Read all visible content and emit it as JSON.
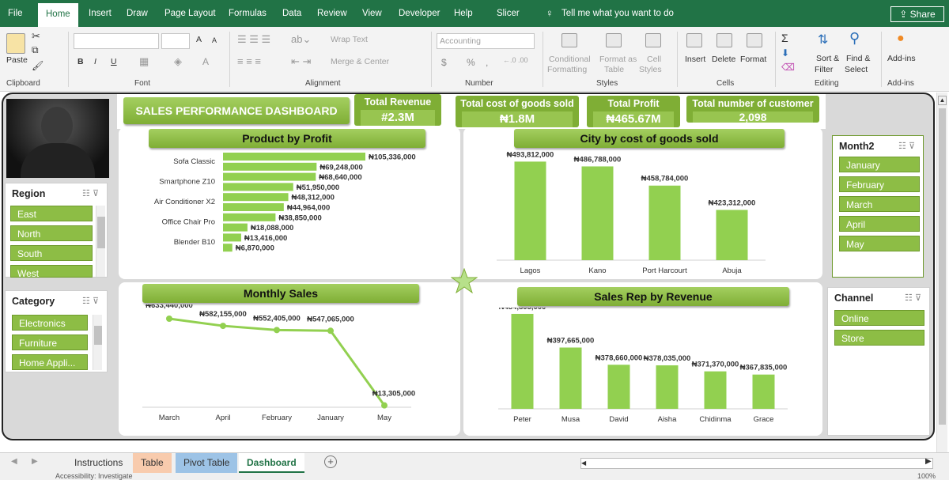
{
  "menu": {
    "items": [
      "File",
      "Home",
      "Insert",
      "Draw",
      "Page Layout",
      "Formulas",
      "Data",
      "Review",
      "View",
      "Developer",
      "Help",
      "Slicer"
    ],
    "tell_me": "Tell me what you want to do",
    "share": "Share"
  },
  "ribbon": {
    "clipboard": {
      "paste": "Paste",
      "label": "Clipboard"
    },
    "font": {
      "bold": "B",
      "italic": "I",
      "underline": "U",
      "grow": "A",
      "shrink": "A",
      "color": "A",
      "label": "Font"
    },
    "alignment": {
      "wrap": "Wrap Text",
      "merge": "Merge & Center",
      "label": "Alignment"
    },
    "number": {
      "format": "Accounting",
      "currency": "$",
      "percent": "%",
      "comma": ",",
      "inc": "←.0 .00",
      "dec": ".00 →.0",
      "label": "Number"
    },
    "styles": {
      "conditional": "Conditional",
      "formatting": "Formatting",
      "format_as": "Format as",
      "table": "Table",
      "cell": "Cell",
      "styles": "Styles",
      "label": "Styles"
    },
    "cells": {
      "insert": "Insert",
      "delete": "Delete",
      "format": "Format",
      "label": "Cells"
    },
    "editing": {
      "sort": "Sort &",
      "filter": "Filter",
      "find": "Find &",
      "select": "Select",
      "label": "Editing"
    },
    "addins": {
      "button": "Add-ins",
      "label": "Add-ins"
    }
  },
  "dashboard": {
    "title": "SALES PERFORMANCE  DASHBOARD",
    "kpis": [
      {
        "label": "Total Revenue",
        "value": "#2.3M"
      },
      {
        "label": "Total cost of goods sold",
        "value": "₦1.8M"
      },
      {
        "label": "Total Profit",
        "value": "₦465.67M"
      },
      {
        "label": "Total number of customer",
        "value": "2,098"
      }
    ]
  },
  "slicers": {
    "region": {
      "title": "Region",
      "items": [
        "East",
        "North",
        "South",
        "West"
      ]
    },
    "category": {
      "title": "Category",
      "items": [
        "Electronics",
        "Furniture",
        "Home Appli..."
      ]
    },
    "month": {
      "title": "Month2",
      "items": [
        "January",
        "February",
        "March",
        "April",
        "May"
      ]
    },
    "channel": {
      "title": "Channel",
      "items": [
        "Online",
        "Store"
      ]
    }
  },
  "chart_data": [
    {
      "type": "bar",
      "orientation": "horizontal",
      "title": "Product by Profit",
      "categories": [
        "",
        "Sofa Classic",
        "",
        "",
        "Smartphone Z10",
        "",
        "",
        "Air Conditioner X2",
        "",
        "",
        "Office Chair Pro",
        "",
        "",
        "Blender B10"
      ],
      "values": [
        105336000,
        69248000,
        68640000,
        51950000,
        48312000,
        44964000,
        38850000,
        18088000,
        13416000,
        6870000
      ],
      "tick_labels": [
        {
          "text": "Sofa Classic",
          "bar": 1
        },
        {
          "text": "Smartphone Z10",
          "bar": 3
        },
        {
          "text": "Air Conditioner X2",
          "bar": 5
        },
        {
          "text": "Office Chair Pro",
          "bar": 7
        },
        {
          "text": "Blender B10",
          "bar": 9
        }
      ],
      "data_labels": [
        "₦105,336,000",
        "₦69,248,000",
        "₦68,640,000",
        "₦51,950,000",
        "₦48,312,000",
        "₦44,964,000",
        "₦38,850,000",
        "₦18,088,000",
        "₦13,416,000",
        "₦6,870,000"
      ],
      "color": "#92d050"
    },
    {
      "type": "bar",
      "title": "City by cost of goods sold",
      "categories": [
        "Lagos",
        "Kano",
        "Port Harcourt",
        "Abuja"
      ],
      "values": [
        493812000,
        486788000,
        458784000,
        423312000
      ],
      "data_labels": [
        "₦493,812,000",
        "₦486,788,000",
        "₦458,784,000",
        "₦423,312,000"
      ],
      "ylim": [
        350000000,
        500000000
      ],
      "color": "#92d050"
    },
    {
      "type": "line",
      "title": "Monthly Sales",
      "categories": [
        "March",
        "April",
        "February",
        "January",
        "May"
      ],
      "values": [
        633440000,
        582155000,
        552405000,
        547065000,
        13305000
      ],
      "data_labels": [
        "₦633,440,000",
        "₦582,155,000",
        "₦552,405,000",
        "₦547,065,000",
        "₦13,305,000"
      ],
      "color": "#92d050"
    },
    {
      "type": "bar",
      "title": "Sales Rep by Revenue",
      "categories": [
        "Peter",
        "Musa",
        "David",
        "Aisha",
        "Chidinma",
        "Grace"
      ],
      "values": [
        434805000,
        397665000,
        378660000,
        378035000,
        371370000,
        367835000
      ],
      "data_labels": [
        "₦434,805,000",
        "₦397,665,000",
        "₦378,660,000",
        "₦378,035,000",
        "₦371,370,000",
        "₦367,835,000"
      ],
      "ylim": [
        330000000,
        440000000
      ],
      "color": "#92d050"
    }
  ],
  "sheets": {
    "tabs": [
      "Instructions",
      "Table",
      "Pivot Table",
      "Dashboard"
    ],
    "active": "Dashboard",
    "tab_colors": [
      "#f0f0f0",
      "#f8cbad",
      "#9dc3e6",
      "#ffffff"
    ],
    "add": "+"
  },
  "status": {
    "accessibility": "Accessibility: Investigate",
    "zoom": "100%"
  },
  "colors": {
    "excel_green": "#217346",
    "bar_green": "#92d050",
    "pill_green": "#7fae35"
  }
}
